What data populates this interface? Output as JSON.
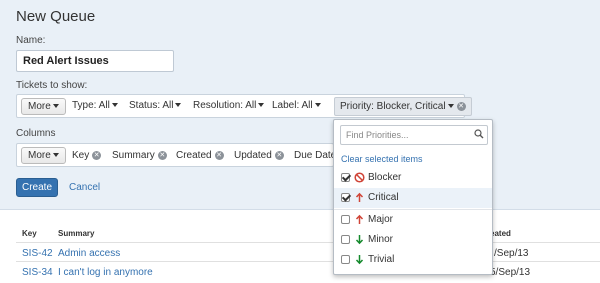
{
  "page": {
    "title": "New Queue"
  },
  "form": {
    "name_label": "Name:",
    "name_value": "Red Alert Issues",
    "tickets_label": "Tickets to show:",
    "columns_label": "Columns"
  },
  "filters": {
    "more": "More",
    "type": "Type: All",
    "status": "Status: All",
    "resolution": "Resolution: All",
    "label": "Label: All",
    "priority": "Priority: Blocker, Critical"
  },
  "columns": {
    "more": "More",
    "items": [
      "Key",
      "Summary",
      "Created",
      "Updated",
      "Due Date"
    ]
  },
  "actions": {
    "create": "Create",
    "cancel": "Cancel"
  },
  "table": {
    "headers": {
      "key": "Key",
      "summary": "Summary",
      "created": "eated"
    },
    "rows": [
      {
        "key": "SIS-42",
        "summary": "Admin access",
        "date": "/Sep/13"
      },
      {
        "key": "SIS-34",
        "summary": "I can't log in anymore",
        "date": "5/Sep/13"
      }
    ]
  },
  "priority_dropdown": {
    "placeholder": "Find Priorities...",
    "clear": "Clear selected items",
    "options": [
      {
        "label": "Blocker",
        "checked": true,
        "icon": "blocker-icon",
        "color": "#d04437"
      },
      {
        "label": "Critical",
        "checked": true,
        "icon": "arrow-up-icon",
        "color": "#d04437"
      },
      {
        "label": "Major",
        "checked": false,
        "icon": "arrow-up-icon",
        "color": "#d04437"
      },
      {
        "label": "Minor",
        "checked": false,
        "icon": "arrow-down-icon",
        "color": "#14892c"
      },
      {
        "label": "Trivial",
        "checked": false,
        "icon": "arrow-down-icon",
        "color": "#14892c"
      }
    ]
  },
  "colors": {
    "panel": "#e9f0f7",
    "link": "#3572b0",
    "primary_button": "#3572b0"
  }
}
